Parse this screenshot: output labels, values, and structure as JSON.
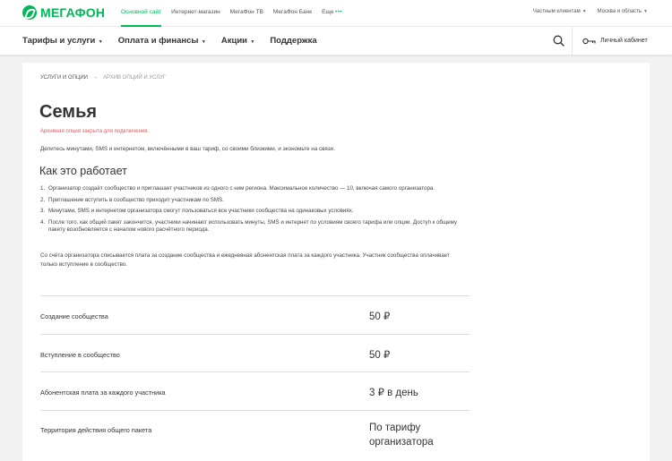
{
  "brand": {
    "name": "МЕГАФОН",
    "color": "#00b956"
  },
  "top_links": [
    {
      "label": "Основной сайт",
      "active": true
    },
    {
      "label": "Интернет-магазин",
      "active": false
    },
    {
      "label": "МегаФон ТВ",
      "active": false
    },
    {
      "label": "МегаФон Банк",
      "active": false
    },
    {
      "label": "Еще",
      "active": false
    }
  ],
  "more_dots": "•••",
  "top_right": {
    "segment": "Частным клиентам",
    "region": "Москва и область"
  },
  "main_nav": [
    {
      "label": "Тарифы и услуги",
      "dropdown": true
    },
    {
      "label": "Оплата и финансы",
      "dropdown": true
    },
    {
      "label": "Акции",
      "dropdown": true
    },
    {
      "label": "Поддержка",
      "dropdown": false
    }
  ],
  "icons": {
    "search": "search-icon",
    "account": "account-icon",
    "dropdown": "chevron-down-icon"
  },
  "cabinet_label": "Личный кабинет",
  "breadcrumb": {
    "parent": "УСЛУГИ И ОПЦИИ",
    "separator": "→",
    "current": "АРХИВ ОПЦИЙ И УСЛУГ"
  },
  "page": {
    "title": "Семья",
    "archived_note": "Архивная опция закрыта для подключения.",
    "archived_color": "#e55c5c",
    "intro": "Делитесь минутами, SMS и интернетом, включёнными в ваш тариф, со своими близкими, и экономьте на связи.",
    "how_title": "Как это работает",
    "steps": [
      {
        "num": "1.",
        "text": "Организатор создаёт сообщество и приглашает участников из одного с ним региона. Максимальное количество — 10, включая самого организатора."
      },
      {
        "num": "2.",
        "text": "Приглашение вступить в сообщество приходит участникам по SMS."
      },
      {
        "num": "3.",
        "text": "Минутами, SMS и интернетом организатора смогут пользоваться все участники сообщества на одинаковых условиях."
      },
      {
        "num": "4.",
        "text": "После того, как общий пакет закончится, участники начинают использовать минуты, SMS и интернет по условиям своего тарифа или опции. Доступ к общему пакету возобновляется с началом нового расчётного периода."
      }
    ],
    "billing_note": "Со счёта организатора списывается плата за создание сообщества и ежедневная абонентская плата за каждого участника. Участник сообщества оплачивает только вступление в сообщество.",
    "prices": [
      {
        "label": "Создание сообщества",
        "value": "50 ₽"
      },
      {
        "label": "Вступление в сообщество",
        "value": "50 ₽"
      },
      {
        "label": "Абонентская плата за каждого участника",
        "value": "3 ₽ в день"
      },
      {
        "label": "Территория действия общего пакета",
        "value": "По тарифу организатора"
      }
    ]
  }
}
